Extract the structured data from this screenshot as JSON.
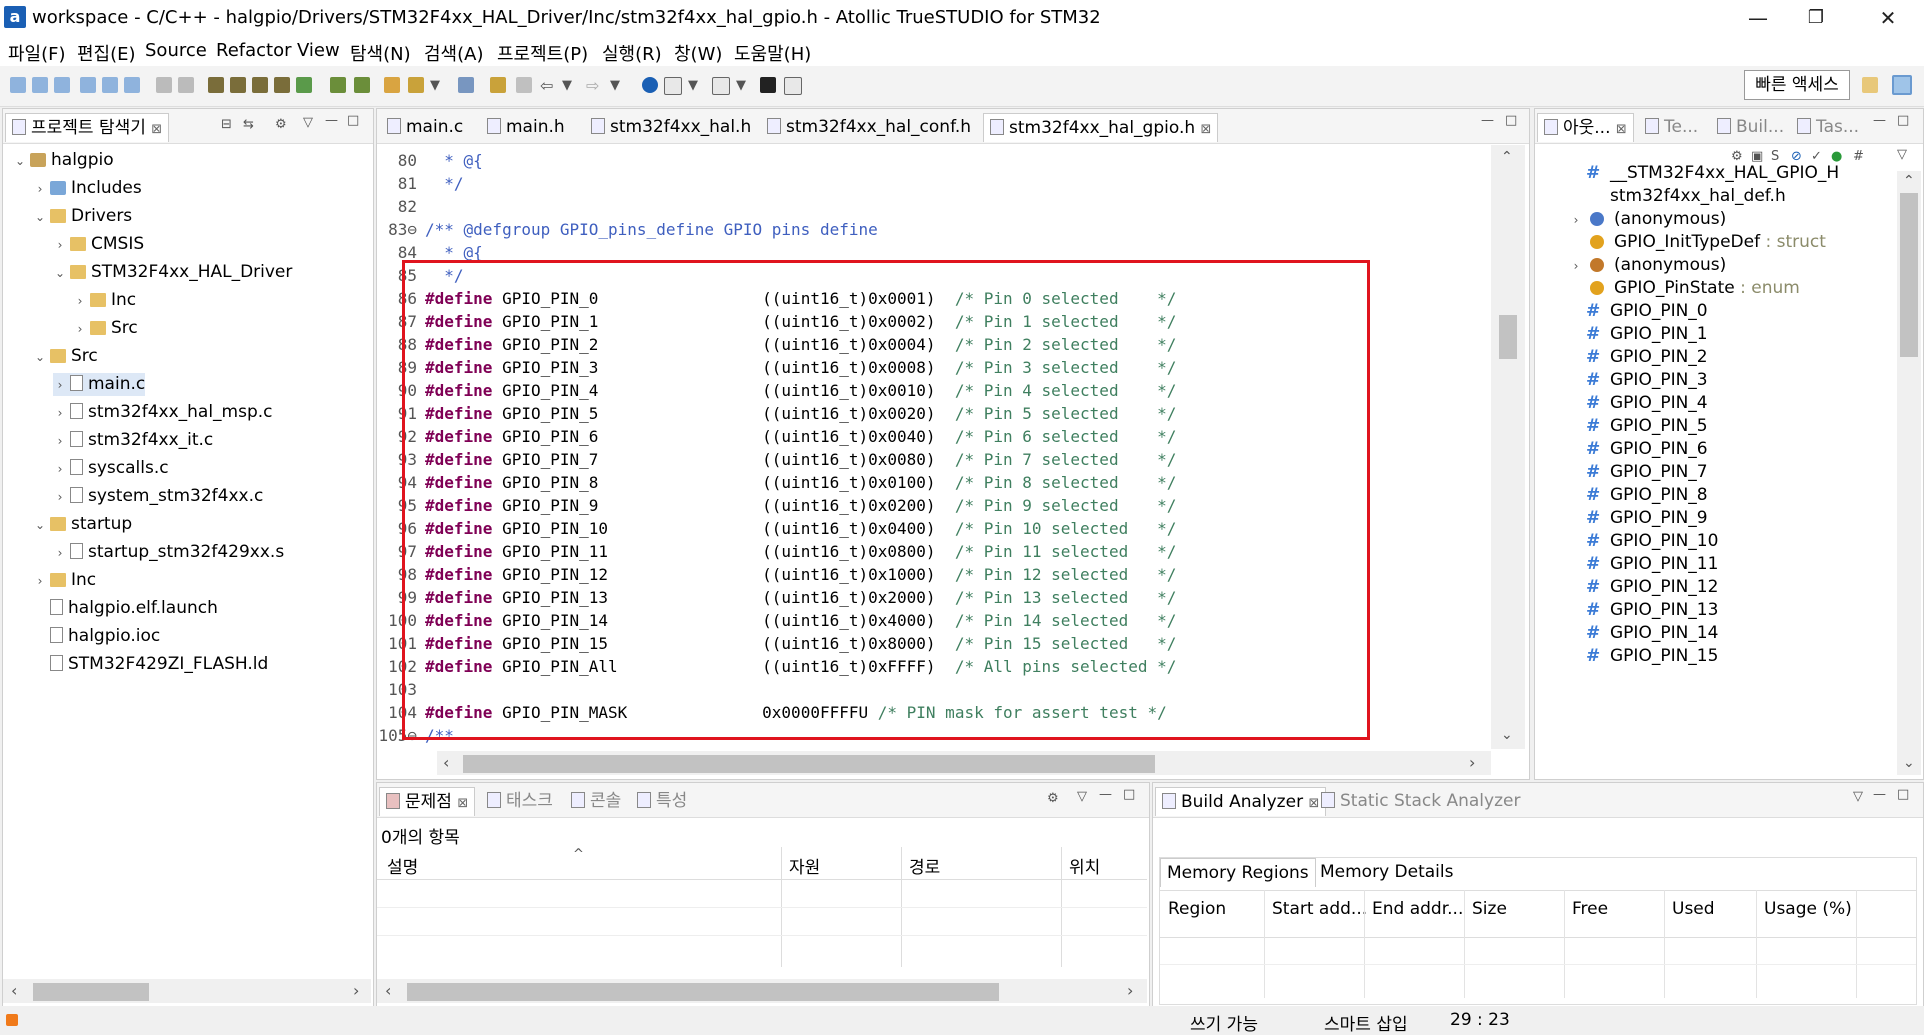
{
  "window": {
    "title": "workspace - C/C++ - halgpio/Drivers/STM32F4xx_HAL_Driver/Inc/stm32f4xx_hal_gpio.h - Atollic TrueSTUDIO for STM32",
    "minimize": "—",
    "restore": "❐",
    "close": "✕"
  },
  "menu": [
    "파일(F)",
    "편집(E)",
    "Source",
    "Refactor",
    "View",
    "탐색(N)",
    "검색(A)",
    "프로젝트(P)",
    "실행(R)",
    "창(W)",
    "도움말(H)"
  ],
  "quick_access": "빠른 액세스",
  "project_explorer": {
    "title": "프로젝트 탐색기",
    "items": [
      {
        "label": "halgpio",
        "twisty": "⌄",
        "icon": "proj",
        "indent": 0
      },
      {
        "label": "Includes",
        "twisty": "›",
        "icon": "inc",
        "indent": 1
      },
      {
        "label": "Drivers",
        "twisty": "⌄",
        "icon": "folder",
        "indent": 1
      },
      {
        "label": "CMSIS",
        "twisty": "›",
        "icon": "folder",
        "indent": 2
      },
      {
        "label": "STM32F4xx_HAL_Driver",
        "twisty": "⌄",
        "icon": "folder",
        "indent": 2
      },
      {
        "label": "Inc",
        "twisty": "›",
        "icon": "folder",
        "indent": 3
      },
      {
        "label": "Src",
        "twisty": "›",
        "icon": "folder",
        "indent": 3
      },
      {
        "label": "Src",
        "twisty": "⌄",
        "icon": "folder",
        "indent": 1
      },
      {
        "label": "main.c",
        "twisty": "›",
        "icon": "file",
        "indent": 2,
        "selected": true
      },
      {
        "label": "stm32f4xx_hal_msp.c",
        "twisty": "›",
        "icon": "file",
        "indent": 2
      },
      {
        "label": "stm32f4xx_it.c",
        "twisty": "›",
        "icon": "file",
        "indent": 2
      },
      {
        "label": "syscalls.c",
        "twisty": "›",
        "icon": "file",
        "indent": 2
      },
      {
        "label": "system_stm32f4xx.c",
        "twisty": "›",
        "icon": "file",
        "indent": 2
      },
      {
        "label": "startup",
        "twisty": "⌄",
        "icon": "folder",
        "indent": 1
      },
      {
        "label": "startup_stm32f429xx.s",
        "twisty": "›",
        "icon": "file",
        "indent": 2
      },
      {
        "label": "Inc",
        "twisty": "›",
        "icon": "folder",
        "indent": 1
      },
      {
        "label": "halgpio.elf.launch",
        "twisty": "",
        "icon": "file",
        "indent": 1
      },
      {
        "label": "halgpio.ioc",
        "twisty": "",
        "icon": "file",
        "indent": 1
      },
      {
        "label": "STM32F429ZI_FLASH.ld",
        "twisty": "",
        "icon": "file",
        "indent": 1
      }
    ]
  },
  "editor": {
    "tabs": [
      "main.c",
      "main.h",
      "stm32f4xx_hal.h",
      "stm32f4xx_hal_conf.h",
      "stm32f4xx_hal_gpio.h"
    ],
    "active_tab": 4,
    "lines": [
      {
        "n": "80",
        "parts": [
          [
            "",
            "  "
          ],
          [
            "cm",
            "* @{"
          ]
        ]
      },
      {
        "n": "81",
        "parts": [
          [
            "",
            "  "
          ],
          [
            "cm",
            "*/"
          ]
        ]
      },
      {
        "n": "82",
        "parts": []
      },
      {
        "n": "83⊖",
        "parts": [
          [
            "cm",
            "/** @defgroup GPIO_pins_define GPIO pins define"
          ]
        ]
      },
      {
        "n": "84",
        "parts": [
          [
            "",
            "  "
          ],
          [
            "cm",
            "* @{"
          ]
        ]
      },
      {
        "n": "85",
        "parts": [
          [
            "",
            "  "
          ],
          [
            "cm",
            "*/"
          ]
        ]
      },
      {
        "n": "86",
        "parts": [
          [
            "kw",
            "#define"
          ],
          [
            "",
            " GPIO_PIN_0                 ((uint16_t)0x0001)  "
          ],
          [
            "cmt",
            "/* Pin 0 selected    */"
          ]
        ]
      },
      {
        "n": "87",
        "parts": [
          [
            "kw",
            "#define"
          ],
          [
            "",
            " GPIO_PIN_1                 ((uint16_t)0x0002)  "
          ],
          [
            "cmt",
            "/* Pin 1 selected    */"
          ]
        ]
      },
      {
        "n": "88",
        "parts": [
          [
            "kw",
            "#define"
          ],
          [
            "",
            " GPIO_PIN_2                 ((uint16_t)0x0004)  "
          ],
          [
            "cmt",
            "/* Pin 2 selected    */"
          ]
        ]
      },
      {
        "n": "89",
        "parts": [
          [
            "kw",
            "#define"
          ],
          [
            "",
            " GPIO_PIN_3                 ((uint16_t)0x0008)  "
          ],
          [
            "cmt",
            "/* Pin 3 selected    */"
          ]
        ]
      },
      {
        "n": "90",
        "parts": [
          [
            "kw",
            "#define"
          ],
          [
            "",
            " GPIO_PIN_4                 ((uint16_t)0x0010)  "
          ],
          [
            "cmt",
            "/* Pin 4 selected    */"
          ]
        ]
      },
      {
        "n": "91",
        "parts": [
          [
            "kw",
            "#define"
          ],
          [
            "",
            " GPIO_PIN_5                 ((uint16_t)0x0020)  "
          ],
          [
            "cmt",
            "/* Pin 5 selected    */"
          ]
        ]
      },
      {
        "n": "92",
        "parts": [
          [
            "kw",
            "#define"
          ],
          [
            "",
            " GPIO_PIN_6                 ((uint16_t)0x0040)  "
          ],
          [
            "cmt",
            "/* Pin 6 selected    */"
          ]
        ]
      },
      {
        "n": "93",
        "parts": [
          [
            "kw",
            "#define"
          ],
          [
            "",
            " GPIO_PIN_7                 ((uint16_t)0x0080)  "
          ],
          [
            "cmt",
            "/* Pin 7 selected    */"
          ]
        ]
      },
      {
        "n": "94",
        "parts": [
          [
            "kw",
            "#define"
          ],
          [
            "",
            " GPIO_PIN_8                 ((uint16_t)0x0100)  "
          ],
          [
            "cmt",
            "/* Pin 8 selected    */"
          ]
        ]
      },
      {
        "n": "95",
        "parts": [
          [
            "kw",
            "#define"
          ],
          [
            "",
            " GPIO_PIN_9                 ((uint16_t)0x0200)  "
          ],
          [
            "cmt",
            "/* Pin 9 selected    */"
          ]
        ]
      },
      {
        "n": "96",
        "parts": [
          [
            "kw",
            "#define"
          ],
          [
            "",
            " GPIO_PIN_10                ((uint16_t)0x0400)  "
          ],
          [
            "cmt",
            "/* Pin 10 selected   */"
          ]
        ]
      },
      {
        "n": "97",
        "parts": [
          [
            "kw",
            "#define"
          ],
          [
            "",
            " GPIO_PIN_11                ((uint16_t)0x0800)  "
          ],
          [
            "cmt",
            "/* Pin 11 selected   */"
          ]
        ]
      },
      {
        "n": "98",
        "parts": [
          [
            "kw",
            "#define"
          ],
          [
            "",
            " GPIO_PIN_12                ((uint16_t)0x1000)  "
          ],
          [
            "cmt",
            "/* Pin 12 selected   */"
          ]
        ]
      },
      {
        "n": "99",
        "parts": [
          [
            "kw",
            "#define"
          ],
          [
            "",
            " GPIO_PIN_13                ((uint16_t)0x2000)  "
          ],
          [
            "cmt",
            "/* Pin 13 selected   */"
          ]
        ]
      },
      {
        "n": "100",
        "parts": [
          [
            "kw",
            "#define"
          ],
          [
            "",
            " GPIO_PIN_14                ((uint16_t)0x4000)  "
          ],
          [
            "cmt",
            "/* Pin 14 selected   */"
          ]
        ]
      },
      {
        "n": "101",
        "parts": [
          [
            "kw",
            "#define"
          ],
          [
            "",
            " GPIO_PIN_15                ((uint16_t)0x8000)  "
          ],
          [
            "cmt",
            "/* Pin 15 selected   */"
          ]
        ]
      },
      {
        "n": "102",
        "parts": [
          [
            "kw",
            "#define"
          ],
          [
            "",
            " GPIO_PIN_All               ((uint16_t)0xFFFF)  "
          ],
          [
            "cmt",
            "/* All pins selected */"
          ]
        ]
      },
      {
        "n": "103",
        "parts": []
      },
      {
        "n": "104",
        "parts": [
          [
            "kw",
            "#define"
          ],
          [
            "",
            " GPIO_PIN_MASK              0x0000FFFFU "
          ],
          [
            "cmt",
            "/* PIN mask for assert test */"
          ]
        ]
      },
      {
        "n": "105⊖",
        "parts": [
          [
            "cm",
            "/**"
          ]
        ]
      }
    ]
  },
  "outline": {
    "tabs": [
      "아웃...",
      "Te...",
      "Buil...",
      "Tas..."
    ],
    "items": [
      {
        "kind": "hash",
        "label": "__STM32F4xx_HAL_GPIO_H",
        "type": "",
        "twisty": ""
      },
      {
        "kind": "none",
        "label": "stm32f4xx_hal_def.h",
        "type": "",
        "twisty": ""
      },
      {
        "kind": "struct",
        "label": "(anonymous)",
        "type": "",
        "twisty": "›"
      },
      {
        "kind": "typedef",
        "label": "GPIO_InitTypeDef",
        "type": " : struct",
        "twisty": ""
      },
      {
        "kind": "enum",
        "label": "(anonymous)",
        "type": "",
        "twisty": "›"
      },
      {
        "kind": "typedef",
        "label": "GPIO_PinState",
        "type": " : enum",
        "twisty": ""
      },
      {
        "kind": "hash",
        "label": "GPIO_PIN_0",
        "type": "",
        "twisty": ""
      },
      {
        "kind": "hash",
        "label": "GPIO_PIN_1",
        "type": "",
        "twisty": ""
      },
      {
        "kind": "hash",
        "label": "GPIO_PIN_2",
        "type": "",
        "twisty": ""
      },
      {
        "kind": "hash",
        "label": "GPIO_PIN_3",
        "type": "",
        "twisty": ""
      },
      {
        "kind": "hash",
        "label": "GPIO_PIN_4",
        "type": "",
        "twisty": ""
      },
      {
        "kind": "hash",
        "label": "GPIO_PIN_5",
        "type": "",
        "twisty": ""
      },
      {
        "kind": "hash",
        "label": "GPIO_PIN_6",
        "type": "",
        "twisty": ""
      },
      {
        "kind": "hash",
        "label": "GPIO_PIN_7",
        "type": "",
        "twisty": ""
      },
      {
        "kind": "hash",
        "label": "GPIO_PIN_8",
        "type": "",
        "twisty": ""
      },
      {
        "kind": "hash",
        "label": "GPIO_PIN_9",
        "type": "",
        "twisty": ""
      },
      {
        "kind": "hash",
        "label": "GPIO_PIN_10",
        "type": "",
        "twisty": ""
      },
      {
        "kind": "hash",
        "label": "GPIO_PIN_11",
        "type": "",
        "twisty": ""
      },
      {
        "kind": "hash",
        "label": "GPIO_PIN_12",
        "type": "",
        "twisty": ""
      },
      {
        "kind": "hash",
        "label": "GPIO_PIN_13",
        "type": "",
        "twisty": ""
      },
      {
        "kind": "hash",
        "label": "GPIO_PIN_14",
        "type": "",
        "twisty": ""
      },
      {
        "kind": "hash",
        "label": "GPIO_PIN_15",
        "type": "",
        "twisty": ""
      }
    ]
  },
  "problems": {
    "tabs": [
      "문제점",
      "태스크",
      "콘솔",
      "특성"
    ],
    "count_text": "0개의 항목",
    "columns": [
      "설명",
      "자원",
      "경로",
      "위치"
    ]
  },
  "build_analyzer": {
    "tabs": [
      "Build Analyzer",
      "Static Stack Analyzer"
    ],
    "subtabs": [
      "Memory Regions",
      "Memory Details"
    ],
    "columns": [
      "Region",
      "Start add...",
      "End addr...",
      "Size",
      "Free",
      "Used",
      "Usage (%)"
    ]
  },
  "status": {
    "writable": "쓰기 가능",
    "insert_mode": "스마트 삽입",
    "position": "29 : 23"
  },
  "colors": {
    "highlight_box": "#e0141e",
    "keyword": "#7f0055",
    "doc_comment": "#3f5fbf",
    "comment": "#3f7f5f"
  }
}
